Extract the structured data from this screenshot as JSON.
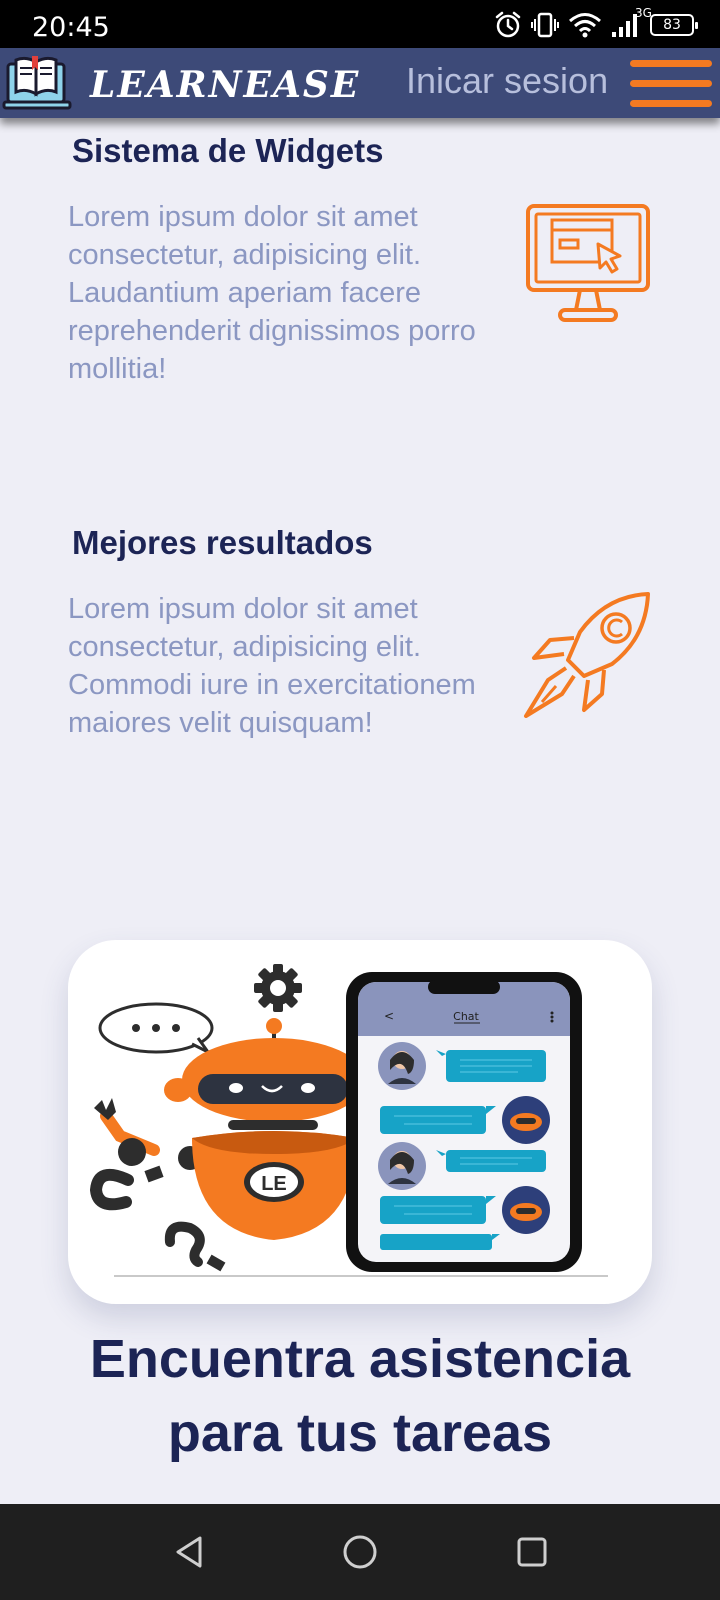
{
  "status_bar": {
    "time": "20:45",
    "network_type": "3G",
    "battery_level": "83",
    "icons": [
      "alarm-icon",
      "vibrate-icon",
      "wifi-icon",
      "signal-icon",
      "battery-icon"
    ]
  },
  "header": {
    "brand": "LEARNEASE",
    "login_label": "Inicar sesion",
    "logo_icon": "book-laptop-icon",
    "menu_icon": "hamburger-menu-icon"
  },
  "features": [
    {
      "title": "Sistema de Widgets",
      "text": "Lorem ipsum dolor sit amet consectetur, adipisicing elit. Laudantium aperiam facere reprehenderit dignissimos porro mollitia!",
      "icon": "monitor-cursor-icon"
    },
    {
      "title": "Mejores resultados",
      "text": "Lorem ipsum dolor sit amet consectetur, adipisicing elit. Commodi iure in exercitationem maiores velit quisquam!",
      "icon": "rocket-icon"
    }
  ],
  "illustration": {
    "phone_header": "Chat",
    "robot_badge": "LE"
  },
  "cta": {
    "title": "Encuentra asistencia para tus tareas"
  },
  "nav_bar": {
    "icons": [
      "back-icon",
      "home-icon",
      "recents-icon"
    ]
  },
  "colors": {
    "accent": "#f47a21",
    "header_bg": "#3d4a78",
    "page_bg": "#eeeef6",
    "heading": "#1c2455",
    "body_text": "#8b97c2",
    "chat_bubble": "#17a3c7"
  }
}
